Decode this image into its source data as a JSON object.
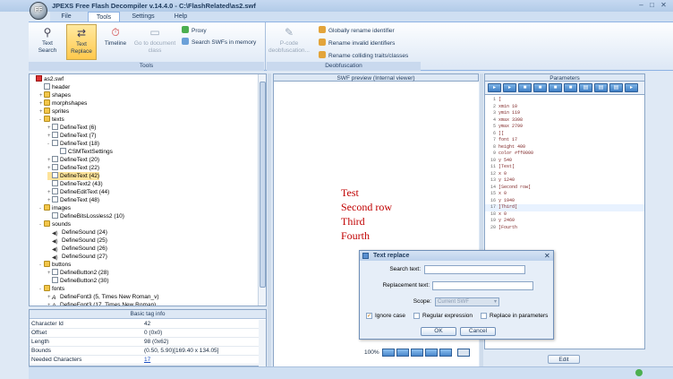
{
  "app": {
    "title": "JPEXS Free Flash Decompiler v.14.4.0 - C:\\FlashRelated\\as2.swf",
    "logo_text": "FF"
  },
  "menu": {
    "tabs": [
      "File",
      "Tools",
      "Settings",
      "Help"
    ],
    "active": "Tools"
  },
  "ribbon": {
    "tools": {
      "label": "Tools",
      "text_search": "Text\nSearch",
      "text_replace": "Text\nReplace",
      "timeline": "Timeline",
      "goto_document_class": "Go to document\nclass",
      "proxy": "Proxy",
      "search_swfs": "Search SWFs in memory"
    },
    "deobfuscation": {
      "label": "Deobfuscation",
      "pcode": "P-code\ndeobfuscation...",
      "global_rename": "Globally rename identifier",
      "rename_invalid": "Rename invalid identifiers",
      "rename_colliding": "Rename colliding traits/classes"
    }
  },
  "tree": {
    "items": [
      {
        "label": "as2.swf",
        "indent": 0,
        "kind": "root"
      },
      {
        "label": "header",
        "indent": 1,
        "kind": "doc"
      },
      {
        "label": "shapes",
        "indent": 1,
        "kind": "fold",
        "pm": "+"
      },
      {
        "label": "morphshapes",
        "indent": 1,
        "kind": "fold",
        "pm": "+"
      },
      {
        "label": "sprites",
        "indent": 1,
        "kind": "fold",
        "pm": "+"
      },
      {
        "label": "texts",
        "indent": 1,
        "kind": "fold",
        "pm": "-"
      },
      {
        "label": "DefineText (6)",
        "indent": 2,
        "kind": "doc",
        "pm": "+"
      },
      {
        "label": "DefineText (7)",
        "indent": 2,
        "kind": "doc",
        "pm": "+"
      },
      {
        "label": "DefineText (18)",
        "indent": 2,
        "kind": "doc",
        "pm": "-"
      },
      {
        "label": "CSMTextSettings",
        "indent": 3,
        "kind": "doc"
      },
      {
        "label": "DefineText (20)",
        "indent": 2,
        "kind": "doc",
        "pm": "+"
      },
      {
        "label": "DefineText (22)",
        "indent": 2,
        "kind": "doc",
        "pm": "+"
      },
      {
        "label": "DefineText (42)",
        "indent": 2,
        "kind": "doc",
        "selected": true
      },
      {
        "label": "DefineText2 (43)",
        "indent": 2,
        "kind": "doc"
      },
      {
        "label": "DefineEditText (44)",
        "indent": 2,
        "kind": "doc",
        "pm": "+"
      },
      {
        "label": "DefineText (48)",
        "indent": 2,
        "kind": "doc",
        "pm": "+"
      },
      {
        "label": "images",
        "indent": 1,
        "kind": "fold",
        "pm": "-"
      },
      {
        "label": "DefineBitsLossless2 (10)",
        "indent": 2,
        "kind": "doc"
      },
      {
        "label": "sounds",
        "indent": 1,
        "kind": "fold",
        "pm": "-"
      },
      {
        "label": "DefineSound (24)",
        "indent": 2,
        "kind": "snd"
      },
      {
        "label": "DefineSound (25)",
        "indent": 2,
        "kind": "snd"
      },
      {
        "label": "DefineSound (26)",
        "indent": 2,
        "kind": "snd"
      },
      {
        "label": "DefineSound (27)",
        "indent": 2,
        "kind": "snd"
      },
      {
        "label": "buttons",
        "indent": 1,
        "kind": "fold",
        "pm": "-"
      },
      {
        "label": "DefineButton2 (28)",
        "indent": 2,
        "kind": "doc",
        "pm": "+"
      },
      {
        "label": "DefineButton2 (30)",
        "indent": 2,
        "kind": "doc"
      },
      {
        "label": "fonts",
        "indent": 1,
        "kind": "fold",
        "pm": "-"
      },
      {
        "label": "DefineFont3 (5, Times New Roman_v)",
        "indent": 2,
        "kind": "font",
        "pm": "+"
      },
      {
        "label": "DefineFont3 (17, Times New Roman)",
        "indent": 2,
        "kind": "font",
        "pm": "+"
      }
    ]
  },
  "basic_info": {
    "title": "Basic tag info",
    "rows": [
      {
        "key": "Character Id",
        "value": "42"
      },
      {
        "key": "Offset",
        "value": "0 (0x0)"
      },
      {
        "key": "Length",
        "value": "98 (0x62)"
      },
      {
        "key": "Bounds",
        "value": "(0.50, 5.90)[169.40 x 134.05]"
      },
      {
        "key": "Needed Characters",
        "value": "17"
      }
    ]
  },
  "preview": {
    "title": "SWF preview (Internal viewer)",
    "texts": [
      "Test",
      "Second row",
      "Third",
      "Fourth"
    ],
    "zoom": "100%"
  },
  "params": {
    "title": "Parameters",
    "lines": [
      "[",
      "xmin 10",
      "ymin 119",
      "xmax 3398",
      "ymax 2799",
      "][",
      "font 17",
      "height 400",
      "color #ff0000",
      "y 540",
      "]Test[",
      "x 0",
      "y 1240",
      "]Second row[",
      "x 0",
      "y 1940",
      "]Third[",
      "x 0",
      "y 2460",
      "]Fourth"
    ],
    "highlight_line": 17,
    "edit_label": "Edit"
  },
  "dialog": {
    "title": "Text replace",
    "search_label": "Search text:",
    "search_value": "",
    "replacement_label": "Replacement text:",
    "replacement_value": "",
    "scope_label": "Scope:",
    "scope_value": "Current SWF",
    "ignore_case": "Ignore case",
    "regex": "Regular expression",
    "replace_params": "Replace in parameters",
    "ok": "OK",
    "cancel": "Cancel"
  },
  "colors": {
    "accent": "#4a88cc",
    "selected": "#fde39a",
    "preview_text": "#c00000"
  }
}
